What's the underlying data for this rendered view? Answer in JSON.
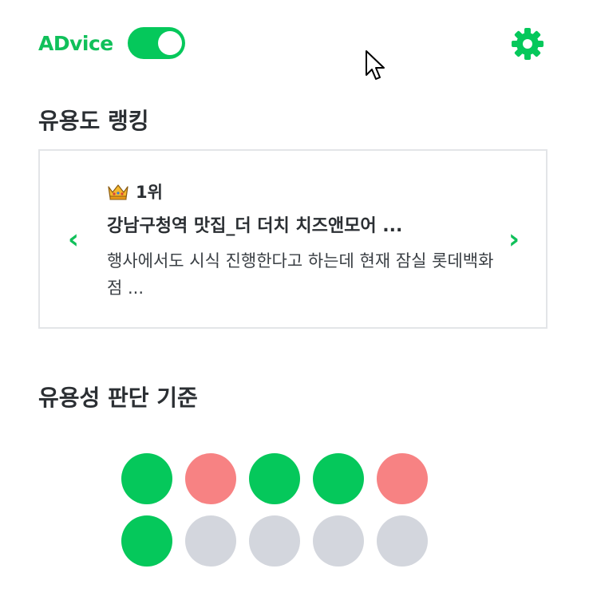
{
  "header": {
    "brand": "ADvice",
    "toggle_on": true
  },
  "ranking": {
    "section_title": "유용도 랭킹",
    "rank_label": "1위",
    "item_title": "강남구청역 맛집_더 더치 치즈앤모어 ...",
    "item_description": "행사에서도 시식 진행한다고 하는데 현재 잠실 롯데백화점 ..."
  },
  "criteria": {
    "section_title": "유용성 판단 기준",
    "dots": [
      {
        "status": "useful",
        "color": "#05c85b"
      },
      {
        "status": "not-useful",
        "color": "#f78283"
      },
      {
        "status": "useful",
        "color": "#05c85b"
      },
      {
        "status": "useful",
        "color": "#05c85b"
      },
      {
        "status": "not-useful",
        "color": "#f78283"
      },
      {
        "status": "useful",
        "color": "#05c85b"
      },
      {
        "status": "empty",
        "color": "#d3d6dd"
      },
      {
        "status": "empty",
        "color": "#d3d6dd"
      },
      {
        "status": "empty",
        "color": "#d3d6dd"
      },
      {
        "status": "empty",
        "color": "#d3d6dd"
      }
    ]
  },
  "icons": {
    "settings": "gear-icon",
    "prev": "chevron-left-icon",
    "next": "chevron-right-icon",
    "rank": "crown-icon"
  },
  "colors": {
    "accent": "#05c85b",
    "negative": "#f78283",
    "neutral": "#d3d6dd",
    "text": "#2b2f33"
  }
}
